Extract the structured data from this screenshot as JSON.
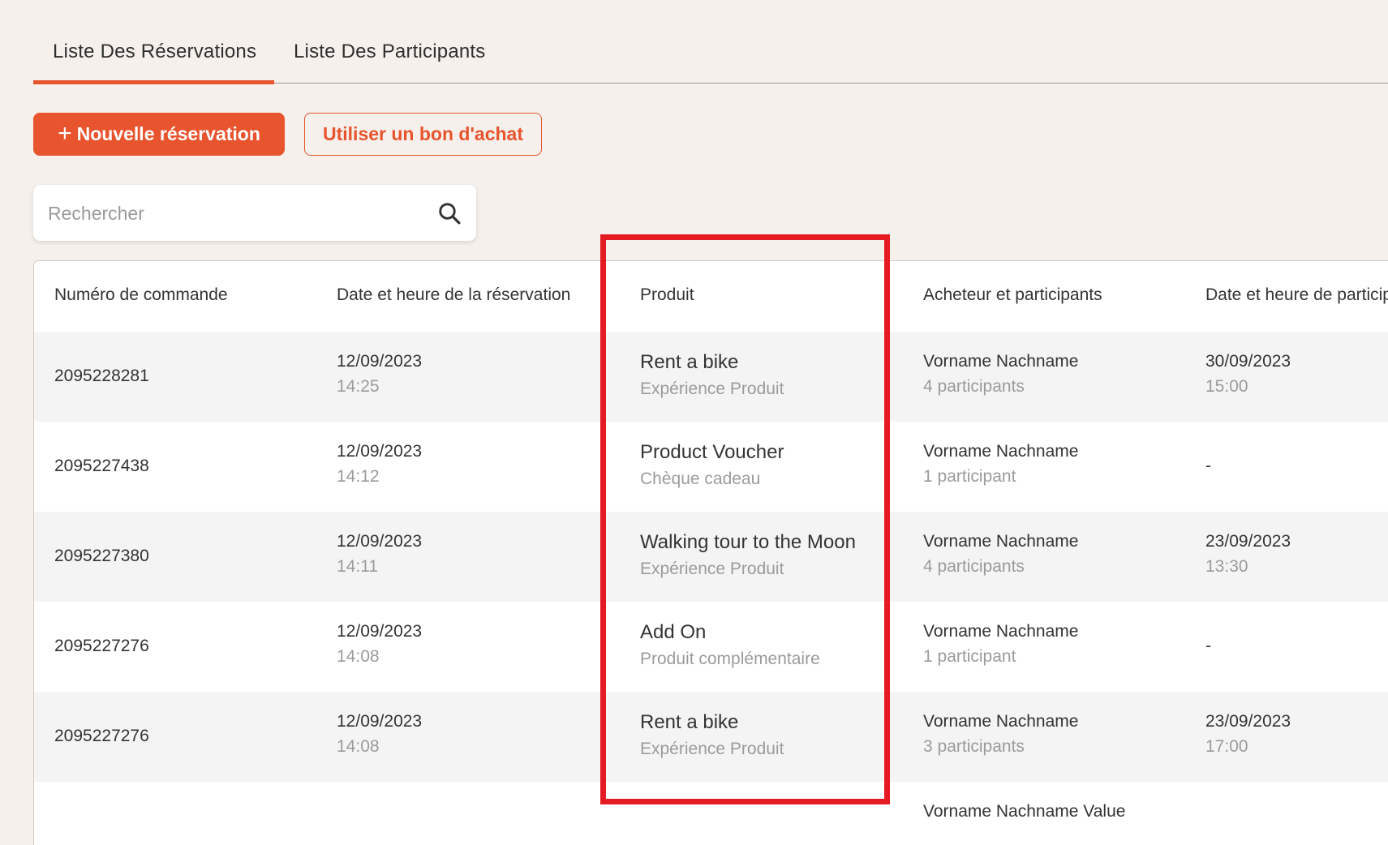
{
  "tabs": [
    {
      "label": "Liste Des Réservations",
      "active": true
    },
    {
      "label": "Liste Des Participants",
      "active": false
    }
  ],
  "actions": {
    "new_booking_label": "Nouvelle réservation",
    "voucher_label": "Utiliser un bon d'achat"
  },
  "search": {
    "placeholder": "Rechercher",
    "value": ""
  },
  "table": {
    "headers": [
      "Numéro de commande",
      "Date et heure de la réservation",
      "Produit",
      "Acheteur et participants",
      "Date et heure de particip"
    ],
    "rows": [
      {
        "order": "2095228281",
        "date": "12/09/2023",
        "time": "14:25",
        "product": "Rent a bike",
        "product_type": "Expérience Produit",
        "buyer": "Vorname Nachname",
        "participants": "4 participants",
        "part_date": "30/09/2023",
        "part_time": "15:00"
      },
      {
        "order": "2095227438",
        "date": "12/09/2023",
        "time": "14:12",
        "product": "Product Voucher",
        "product_type": "Chèque cadeau",
        "buyer": "Vorname Nachname",
        "participants": "1 participant",
        "part_date": "-",
        "part_time": ""
      },
      {
        "order": "2095227380",
        "date": "12/09/2023",
        "time": "14:11",
        "product": "Walking tour to the Moon",
        "product_type": "Expérience Produit",
        "buyer": "Vorname Nachname",
        "participants": "4 participants",
        "part_date": "23/09/2023",
        "part_time": "13:30"
      },
      {
        "order": "2095227276",
        "date": "12/09/2023",
        "time": "14:08",
        "product": "Add On",
        "product_type": "Produit complémentaire",
        "buyer": "Vorname Nachname",
        "participants": "1 participant",
        "part_date": "-",
        "part_time": ""
      },
      {
        "order": "2095227276",
        "date": "12/09/2023",
        "time": "14:08",
        "product": "Rent a bike",
        "product_type": "Expérience Produit",
        "buyer": "Vorname Nachname",
        "participants": "3 participants",
        "part_date": "23/09/2023",
        "part_time": "17:00"
      },
      {
        "order": "",
        "date": "",
        "time": "",
        "product": "",
        "product_type": "",
        "buyer": "Vorname Nachname Value",
        "participants": "",
        "part_date": "",
        "part_time": ""
      }
    ]
  },
  "colors": {
    "accent": "#e8542e",
    "highlight": "#e51b23",
    "background": "#f5f0eb"
  },
  "icons": {
    "search": "search-icon",
    "add": "plus-icon"
  }
}
